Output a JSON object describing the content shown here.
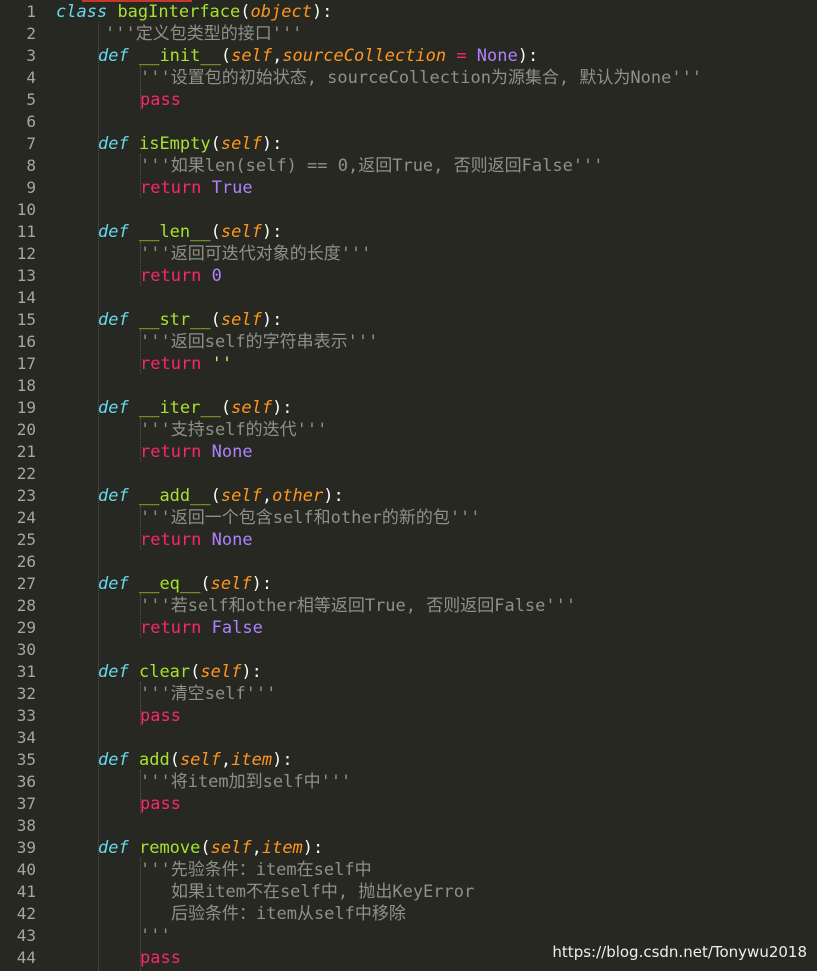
{
  "line_numbers": [
    "1",
    "2",
    "3",
    "4",
    "5",
    "6",
    "7",
    "8",
    "9",
    "10",
    "11",
    "12",
    "13",
    "14",
    "15",
    "16",
    "17",
    "18",
    "19",
    "20",
    "21",
    "22",
    "23",
    "24",
    "25",
    "26",
    "27",
    "28",
    "29",
    "30",
    "31",
    "32",
    "33",
    "34",
    "35",
    "36",
    "37",
    "38",
    "39",
    "40",
    "41",
    "42",
    "43",
    "44"
  ],
  "code": {
    "class_kw": "class",
    "class_name": "bagInterface",
    "base": "object",
    "class_doc": "'''定义包类型的接口'''",
    "def": "def",
    "self": "self",
    "pass": "pass",
    "return": "return",
    "init_name": "__init__",
    "source_param": "sourceCollection",
    "eq_op": " = ",
    "none": "None",
    "init_doc": "'''设置包的初始状态, sourceCollection为源集合, 默认为None'''",
    "isempty_name": "isEmpty",
    "isempty_doc": "'''如果len(self) == 0,返回True, 否则返回False'''",
    "true": "True",
    "len_name": "__len__",
    "len_doc": "'''返回可迭代对象的长度'''",
    "zero": "0",
    "str_name": "__str__",
    "str_doc": "'''返回self的字符串表示'''",
    "empty_str": "''",
    "iter_name": "__iter__",
    "iter_doc": "'''支持self的迭代'''",
    "add_dunder_name": "__add__",
    "other": "other",
    "add_dunder_doc": "'''返回一个包含self和other的新的包'''",
    "eq_name": "__eq__",
    "eq_doc": "'''若self和other相等返回True, 否则返回False'''",
    "false": "False",
    "clear_name": "clear",
    "clear_doc": "'''清空self'''",
    "add_name": "add",
    "item": "item",
    "add_doc": "'''将item加到self中'''",
    "remove_name": "remove",
    "remove_doc_1": "'''先验条件：item在self中",
    "remove_doc_2": "如果item不在self中, 抛出KeyError",
    "remove_doc_3": "后验条件：item从self中移除",
    "remove_doc_4": "'''"
  },
  "watermark": "https://blog.csdn.net/Tonywu2018"
}
